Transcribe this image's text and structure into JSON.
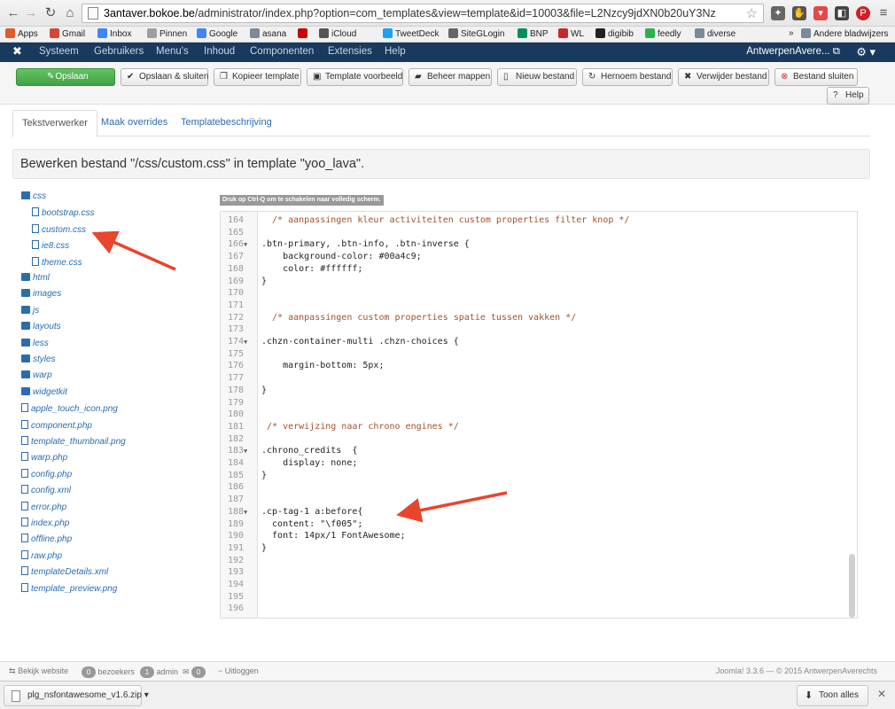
{
  "browser": {
    "url_host": "3antaver.bokoe.be",
    "url_path": "/administrator/index.php?option=com_templates&view=template&id=10003&file=L2Nzcy9jdXN0b20uY3Nz",
    "bookmarks": [
      {
        "label": "Apps",
        "color": "#e05a2b"
      },
      {
        "label": "Gmail",
        "color": "#d14836"
      },
      {
        "label": "Inbox",
        "color": "#4285f4"
      },
      {
        "label": "Pinnen",
        "color": "#9e9e9e"
      },
      {
        "label": "Google",
        "color": "#4285f4"
      },
      {
        "label": "asana",
        "color": "#7a8a9a"
      },
      {
        "label": "",
        "color": "#cc0000"
      },
      {
        "label": "iCloud",
        "color": "#555555"
      },
      {
        "label": "TweetDeck",
        "color": "#1da1f2"
      },
      {
        "label": "SiteGLogin",
        "color": "#666666"
      },
      {
        "label": "BNP",
        "color": "#00915a"
      },
      {
        "label": "WL",
        "color": "#c62828"
      },
      {
        "label": "digibib",
        "color": "#222222"
      },
      {
        "label": "feedly",
        "color": "#2bb24c"
      },
      {
        "label": "diverse",
        "color": "#7a8a9a"
      }
    ],
    "bookmarks_more": "»",
    "bookmarks_other": "Andere bladwijzers"
  },
  "joomla": {
    "menu": [
      "Systeem",
      "Gebruikers",
      "Menu's",
      "Inhoud",
      "Componenten",
      "Extensies",
      "Help"
    ],
    "user": "AntwerpenAvere... ⧉",
    "toolbar": {
      "save": "Opslaan",
      "save_close": "Opslaan & sluiten",
      "copy": "Kopieer template",
      "preview": "Template voorbeeld",
      "manage": "Beheer mappen",
      "new_file": "Nieuw bestand",
      "rename": "Hernoem bestand",
      "delete": "Verwijder bestand",
      "close": "Bestand sluiten",
      "help": "Help"
    },
    "tabs": [
      "Tekstverwerker",
      "Maak overrides",
      "Templatebeschrijving"
    ],
    "edit_title": "Bewerken bestand \"/css/custom.css\" in template \"yoo_lava\".",
    "fullscreen_hint": "Druk op Ctrl-Q om te schakelen naar volledig scherm."
  },
  "tree": [
    {
      "label": "css",
      "type": "folder",
      "indent": 0
    },
    {
      "label": "bootstrap.css",
      "type": "file",
      "indent": 1
    },
    {
      "label": "custom.css",
      "type": "file",
      "indent": 1
    },
    {
      "label": "ie8.css",
      "type": "file",
      "indent": 1
    },
    {
      "label": "theme.css",
      "type": "file",
      "indent": 1
    },
    {
      "label": "html",
      "type": "folder",
      "indent": 0
    },
    {
      "label": "images",
      "type": "folder",
      "indent": 0
    },
    {
      "label": "js",
      "type": "folder",
      "indent": 0
    },
    {
      "label": "layouts",
      "type": "folder",
      "indent": 0
    },
    {
      "label": "less",
      "type": "folder",
      "indent": 0
    },
    {
      "label": "styles",
      "type": "folder",
      "indent": 0
    },
    {
      "label": "warp",
      "type": "folder",
      "indent": 0
    },
    {
      "label": "widgetkit",
      "type": "folder",
      "indent": 0
    },
    {
      "label": "apple_touch_icon.png",
      "type": "file",
      "indent": 0
    },
    {
      "label": "component.php",
      "type": "file",
      "indent": 0
    },
    {
      "label": "template_thumbnail.png",
      "type": "file",
      "indent": 0
    },
    {
      "label": "warp.php",
      "type": "file",
      "indent": 0
    },
    {
      "label": "config.php",
      "type": "file",
      "indent": 0
    },
    {
      "label": "config.xml",
      "type": "file",
      "indent": 0
    },
    {
      "label": "error.php",
      "type": "file",
      "indent": 0
    },
    {
      "label": "index.php",
      "type": "file",
      "indent": 0
    },
    {
      "label": "offline.php",
      "type": "file",
      "indent": 0
    },
    {
      "label": "raw.php",
      "type": "file",
      "indent": 0
    },
    {
      "label": "templateDetails.xml",
      "type": "file",
      "indent": 0
    },
    {
      "label": "template_preview.png",
      "type": "file",
      "indent": 0
    }
  ],
  "code": [
    {
      "n": "164",
      "fold": "",
      "text": "  /* aanpassingen kleur activiteiten custom properties filter knop */",
      "comment": true
    },
    {
      "n": "165",
      "fold": "",
      "text": ""
    },
    {
      "n": "166",
      "fold": "▼",
      "text": ".btn-primary, .btn-info, .btn-inverse {"
    },
    {
      "n": "167",
      "fold": "",
      "text": "    background-color: #00a4c9;"
    },
    {
      "n": "168",
      "fold": "",
      "text": "    color: #ffffff;"
    },
    {
      "n": "169",
      "fold": "",
      "text": "}"
    },
    {
      "n": "170",
      "fold": "",
      "text": ""
    },
    {
      "n": "171",
      "fold": "",
      "text": ""
    },
    {
      "n": "172",
      "fold": "",
      "text": "  /* aanpassingen custom properties spatie tussen vakken */",
      "comment": true
    },
    {
      "n": "173",
      "fold": "",
      "text": ""
    },
    {
      "n": "174",
      "fold": "▼",
      "text": ".chzn-container-multi .chzn-choices {"
    },
    {
      "n": "175",
      "fold": "",
      "text": ""
    },
    {
      "n": "176",
      "fold": "",
      "text": "    margin-bottom: 5px;"
    },
    {
      "n": "177",
      "fold": "",
      "text": ""
    },
    {
      "n": "178",
      "fold": "",
      "text": "}"
    },
    {
      "n": "179",
      "fold": "",
      "text": ""
    },
    {
      "n": "180",
      "fold": "",
      "text": ""
    },
    {
      "n": "181",
      "fold": "",
      "text": " /* verwijzing naar chrono engines */",
      "comment": true
    },
    {
      "n": "182",
      "fold": "",
      "text": ""
    },
    {
      "n": "183",
      "fold": "▼",
      "text": ".chrono_credits  {"
    },
    {
      "n": "184",
      "fold": "",
      "text": "    display: none;"
    },
    {
      "n": "185",
      "fold": "",
      "text": "}"
    },
    {
      "n": "186",
      "fold": "",
      "text": ""
    },
    {
      "n": "187",
      "fold": "",
      "text": ""
    },
    {
      "n": "188",
      "fold": "▼",
      "text": ".cp-tag-1 a:before{"
    },
    {
      "n": "189",
      "fold": "",
      "text": "  content: \"\\f005\";"
    },
    {
      "n": "190",
      "fold": "",
      "text": "  font: 14px/1 FontAwesome;"
    },
    {
      "n": "191",
      "fold": "",
      "text": "}"
    },
    {
      "n": "192",
      "fold": "",
      "text": ""
    },
    {
      "n": "193",
      "fold": "",
      "text": ""
    },
    {
      "n": "194",
      "fold": "",
      "text": ""
    },
    {
      "n": "195",
      "fold": "",
      "text": ""
    },
    {
      "n": "196",
      "fold": "",
      "text": ""
    }
  ],
  "footer": {
    "view_site": "Bekijk website",
    "visitors_count": "0",
    "visitors_label": "bezoekers",
    "admin_count": "1",
    "admin_label": "admin",
    "logout_count": "0",
    "logout_label": "Uitloggen",
    "version": "Joomla! 3.3.6 — © 2015 AntwerpenAverechts"
  },
  "downloads": {
    "file": "plg_nsfontawesome_v1.6.zip",
    "show_all": "Toon alles"
  },
  "colors": {
    "joomla_nav": "#173a5e",
    "save_green": "#46a546",
    "link_blue": "#2a6cb0",
    "annotation_arrow": "#e8452c"
  }
}
